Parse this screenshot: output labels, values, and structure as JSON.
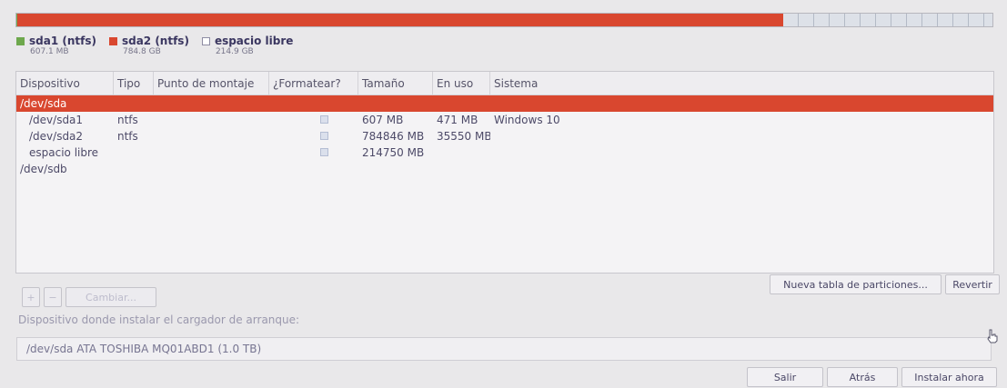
{
  "colors": {
    "sda1": "#6ea84d",
    "sda2": "#d9472f",
    "free": "#dde1e8",
    "selection": "#d9472f"
  },
  "partition_bar": {
    "segments": [
      {
        "name": "sda1",
        "fraction": 0.0006
      },
      {
        "name": "sda2",
        "fraction": 0.7848
      },
      {
        "name": "free",
        "fraction": 0.2146
      }
    ]
  },
  "legend": [
    {
      "label": "sda1 (ntfs)",
      "size": "607.1 MB",
      "color": "#6ea84d"
    },
    {
      "label": "sda2 (ntfs)",
      "size": "784.8 GB",
      "color": "#d9472f"
    },
    {
      "label": "espacio libre",
      "size": "214.9 GB",
      "color": "#ffffff"
    }
  ],
  "table": {
    "headers": {
      "device": "Dispositivo",
      "type": "Tipo",
      "mount": "Punto de montaje",
      "format": "¿Formatear?",
      "size": "Tamaño",
      "used": "En uso",
      "system": "Sistema"
    },
    "rows": [
      {
        "device": "/dev/sda",
        "type": "",
        "mount": "",
        "format": false,
        "size": "",
        "used": "",
        "system": "",
        "selected": true,
        "child": false
      },
      {
        "device": "/dev/sda1",
        "type": "ntfs",
        "mount": "",
        "format": true,
        "size": "607 MB",
        "used": "471 MB",
        "system": "Windows 10",
        "selected": false,
        "child": true
      },
      {
        "device": "/dev/sda2",
        "type": "ntfs",
        "mount": "",
        "format": true,
        "size": "784846 MB",
        "used": "35550 MB",
        "system": "",
        "selected": false,
        "child": true
      },
      {
        "device": "espacio libre",
        "type": "",
        "mount": "",
        "format": true,
        "size": "214750 MB",
        "used": "",
        "system": "",
        "selected": false,
        "child": true
      },
      {
        "device": "/dev/sdb",
        "type": "",
        "mount": "",
        "format": false,
        "size": "",
        "used": "",
        "system": "",
        "selected": false,
        "child": false
      }
    ]
  },
  "toolbar": {
    "add_label": "+",
    "remove_label": "−",
    "change_label": "Cambiar...",
    "new_table_label": "Nueva tabla de particiones...",
    "revert_label": "Revertir"
  },
  "bootloader": {
    "label": "Dispositivo donde instalar el cargador de arranque:",
    "value": "/dev/sda   ATA TOSHIBA MQ01ABD1 (1.0 TB)"
  },
  "footer": {
    "quit_label": "Salir",
    "back_label": "Atrás",
    "install_label": "Instalar ahora"
  }
}
